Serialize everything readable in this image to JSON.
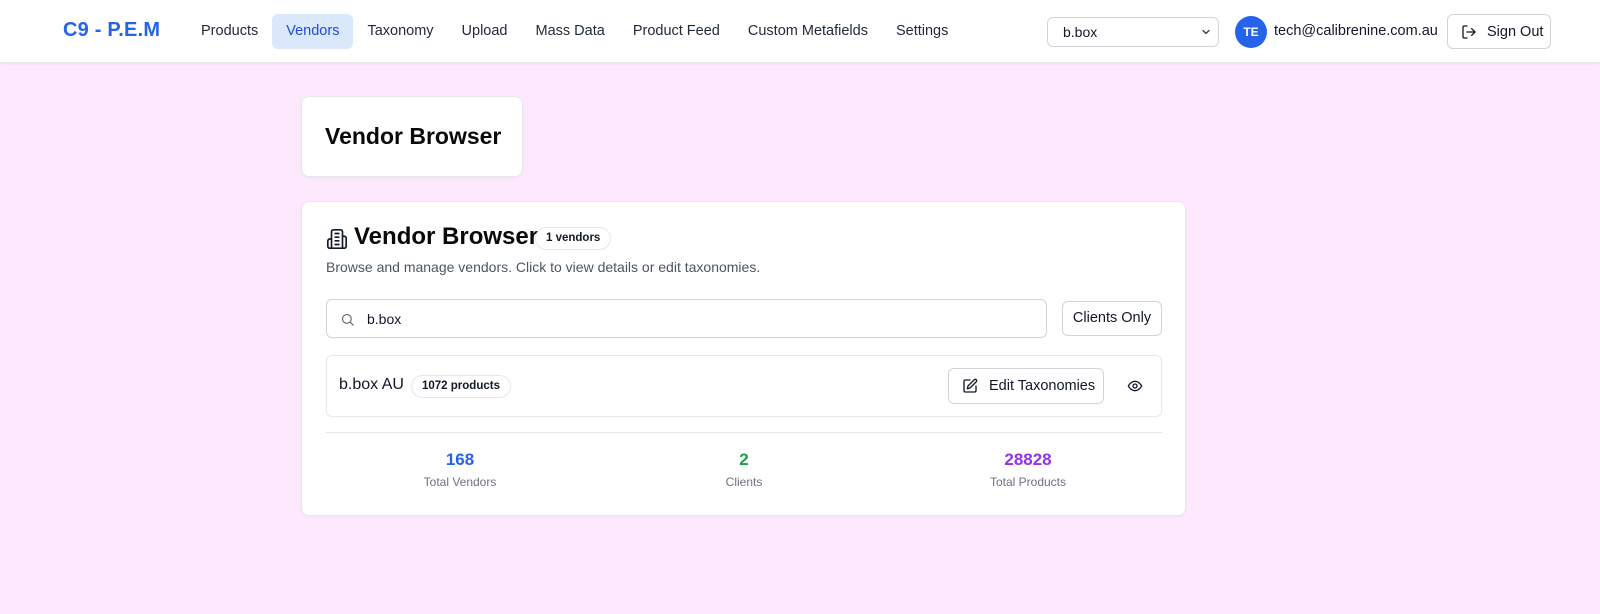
{
  "app": {
    "brand": "C9 - P.E.M"
  },
  "nav": {
    "items": [
      {
        "label": "Products"
      },
      {
        "label": "Vendors",
        "active": true
      },
      {
        "label": "Taxonomy"
      },
      {
        "label": "Upload"
      },
      {
        "label": "Mass Data"
      },
      {
        "label": "Product Feed"
      },
      {
        "label": "Custom Metafields"
      },
      {
        "label": "Settings"
      }
    ]
  },
  "store_select": {
    "value": "b.box",
    "icon": "chevron-down-icon"
  },
  "user": {
    "initials": "TE",
    "email": "tech@calibrenine.com.au"
  },
  "sign_out": {
    "label": "Sign Out",
    "icon": "log-out-icon"
  },
  "page": {
    "title": "Vendor Browser"
  },
  "browser": {
    "icon": "building-icon",
    "title": "Vendor Browser",
    "count_badge": "1 vendors",
    "description": "Browse and manage vendors. Click to view details or edit taxonomies.",
    "search": {
      "value": "b.box",
      "icon": "search-icon"
    },
    "clients_only_label": "Clients Only",
    "vendors": [
      {
        "name": "b.box AU",
        "products_badge": "1072 products",
        "edit_label": "Edit Taxonomies",
        "edit_icon": "pencil-square-icon",
        "view_icon": "eye-icon"
      }
    ],
    "stats": [
      {
        "value": "168",
        "label": "Total Vendors",
        "color": "#2563eb"
      },
      {
        "value": "2",
        "label": "Clients",
        "color": "#16a34a"
      },
      {
        "value": "28828",
        "label": "Total Products",
        "color": "#9333ea"
      }
    ]
  },
  "colors": {
    "accent": "#2563eb",
    "background": "#fde8fd",
    "active_nav_bg": "#dbe7fb"
  }
}
